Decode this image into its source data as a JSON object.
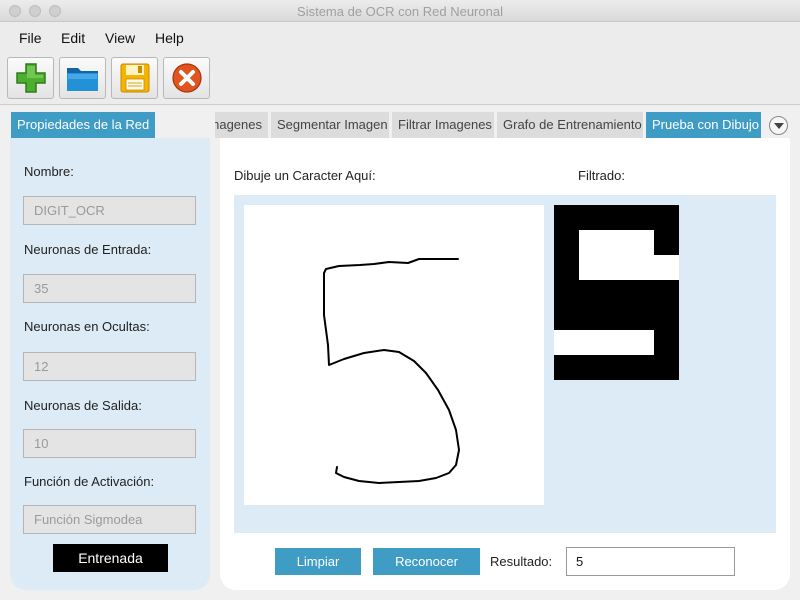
{
  "window": {
    "title": "Sistema de OCR con Red Neuronal"
  },
  "menu": [
    "File",
    "Edit",
    "View",
    "Help"
  ],
  "toolbar": {
    "buttons": [
      {
        "icon": "add-icon",
        "color": "#4caf2f"
      },
      {
        "icon": "folder-icon",
        "color": "#1f86c8"
      },
      {
        "icon": "save-icon",
        "color": "#f4b400"
      },
      {
        "icon": "close-icon",
        "color": "#e0541f"
      }
    ]
  },
  "left_panel": {
    "tab": "Propiedades de la Red",
    "fields": [
      {
        "label": "Nombre:",
        "value": "DIGIT_OCR"
      },
      {
        "label": "Neuronas de Entrada:",
        "value": "35"
      },
      {
        "label": "Neuronas en Ocultas:",
        "value": "12"
      },
      {
        "label": "Neuronas de Salida:",
        "value": "10"
      },
      {
        "label": "Función de Activación:",
        "value": "Función Sigmodea"
      }
    ],
    "status": "Entrenada"
  },
  "tabs": [
    {
      "label": "Imagenes",
      "active": false
    },
    {
      "label": "Segmentar Imagen",
      "active": false
    },
    {
      "label": "Filtrar Imagenes",
      "active": false
    },
    {
      "label": "Grafo de Entrenamiento",
      "active": false
    },
    {
      "label": "Prueba con Dibujo",
      "active": true
    }
  ],
  "drawing_tab": {
    "draw_label": "Dibuje un Caracter Aquí:",
    "filtered_label": "Filtrado:",
    "filtered_grid": [
      [
        1,
        1,
        1,
        1,
        1
      ],
      [
        1,
        0,
        0,
        0,
        1
      ],
      [
        1,
        0,
        0,
        0,
        0
      ],
      [
        1,
        1,
        1,
        1,
        1
      ],
      [
        1,
        1,
        1,
        1,
        1
      ],
      [
        0,
        0,
        0,
        0,
        1
      ],
      [
        1,
        1,
        1,
        1,
        1
      ]
    ],
    "clear_button": "Limpiar",
    "recognize_button": "Reconocer",
    "result_label": "Resultado:",
    "result_value": "5"
  },
  "colors": {
    "accent": "#3f9cc5",
    "panel_bg": "#dcebf5"
  }
}
